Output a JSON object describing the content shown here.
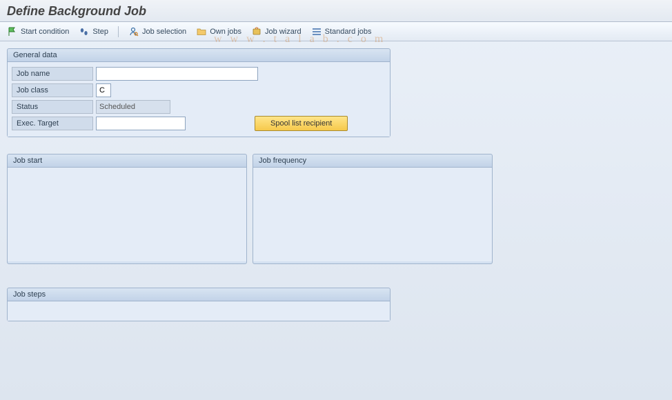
{
  "header": {
    "title": "Define Background Job"
  },
  "toolbar": {
    "start_condition": "Start condition",
    "step": "Step",
    "job_selection": "Job selection",
    "own_jobs": "Own jobs",
    "job_wizard": "Job wizard",
    "standard_jobs": "Standard jobs"
  },
  "general_data": {
    "title": "General data",
    "job_name_label": "Job name",
    "job_name_value": "",
    "job_class_label": "Job class",
    "job_class_value": "C",
    "status_label": "Status",
    "status_value": "Scheduled",
    "exec_target_label": "Exec. Target",
    "exec_target_value": "",
    "spool_button": "Spool list recipient"
  },
  "job_start": {
    "title": "Job start"
  },
  "job_frequency": {
    "title": "Job frequency"
  },
  "job_steps": {
    "title": "Job steps"
  },
  "watermark": "w w w . t a l a b . c o m"
}
